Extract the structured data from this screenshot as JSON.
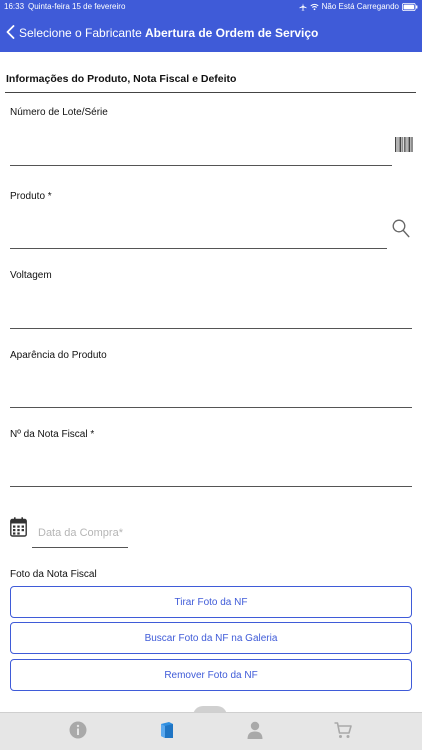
{
  "status_bar": {
    "time": "16:33",
    "date": "Quinta-feira 15 de fevereiro",
    "battery_status": "Não Está Carregando"
  },
  "nav": {
    "back_label": "Selecione o Fabricante",
    "title": "Abertura de Ordem de Serviço"
  },
  "section": {
    "title": "Informações do Produto, Nota Fiscal e Defeito"
  },
  "fields": {
    "lot_serial": {
      "label": "Número de Lote/Série",
      "value": ""
    },
    "product": {
      "label": "Produto *",
      "value": ""
    },
    "voltage": {
      "label": "Voltagem",
      "value": ""
    },
    "appearance": {
      "label": "Aparência do Produto",
      "value": ""
    },
    "invoice_number": {
      "label": "Nº da Nota Fiscal *",
      "value": ""
    },
    "purchase_date": {
      "placeholder": "Data da Compra*"
    }
  },
  "invoice_photo": {
    "label": "Foto da Nota Fiscal",
    "take_photo": "Tirar Foto da NF",
    "gallery": "Buscar Foto da NF na Galeria",
    "remove": "Remover Foto da NF"
  },
  "tabs": [
    {
      "icon": "info-icon"
    },
    {
      "icon": "book-icon",
      "active": true
    },
    {
      "icon": "user-icon"
    },
    {
      "icon": "cart-icon"
    }
  ],
  "colors": {
    "brand": "#3f5bd8",
    "tab_active": "#2f8fe0",
    "tab_inactive": "#a9a9a9"
  }
}
